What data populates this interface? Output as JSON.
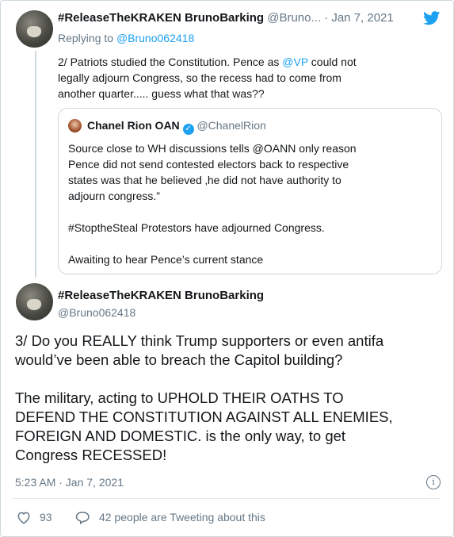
{
  "reply_tweet": {
    "display_name": "#ReleaseTheKRAKEN BrunoBarking",
    "handle": "@Bruno...",
    "separator": " · ",
    "date": "Jan 7, 2021",
    "replying_prefix": "Replying to ",
    "replying_handle": "@Bruno062418",
    "text_1": "2/ Patriots studied the Constitution. Pence as ",
    "mention": "@VP",
    "text_2": " could not",
    "line_2": "legally adjourn Congress, so the recess had to come from",
    "line_3": "another quarter..... guess what that was??"
  },
  "quoted_tweet": {
    "display_name": "Chanel Rion OAN",
    "verified_glyph": "✓",
    "handle": "@ChanelRion",
    "lines": [
      "Source close to WH discussions tells @OANN only reason",
      "Pence did not send contested electors back to respective",
      "states was that he believed ‚he did not have authority to",
      "adjourn congress.”",
      "#StoptheSteal Protestors have adjourned Congress.",
      "Awaiting to hear Pence’s current stance"
    ]
  },
  "main_tweet": {
    "display_name": "#ReleaseTheKRAKEN BrunoBarking",
    "handle": "@Bruno062418",
    "lines": [
      "3/ Do you REALLY think Trump supporters or even antifa",
      "would’ve been able to breach the Capitol building?",
      "The military, acting to UPHOLD THEIR OATHS TO",
      "DEFEND THE CONSTITUTION  AGAINST ALL ENEMIES,",
      "FOREIGN AND DOMESTIC. is the only way, to get",
      "Congress RECESSED!"
    ],
    "timestamp": "5:23 AM · Jan 7, 2021",
    "info_glyph": "i",
    "like_count": "93",
    "tweeting_text": "42 people are Tweeting about this"
  },
  "colors": {
    "accent": "#1da1f2",
    "muted": "#657786",
    "border": "#cfd9de"
  },
  "icons": [
    "twitter-bird-icon",
    "verified-badge-icon",
    "info-icon",
    "heart-icon",
    "comment-bubble-icon"
  ]
}
